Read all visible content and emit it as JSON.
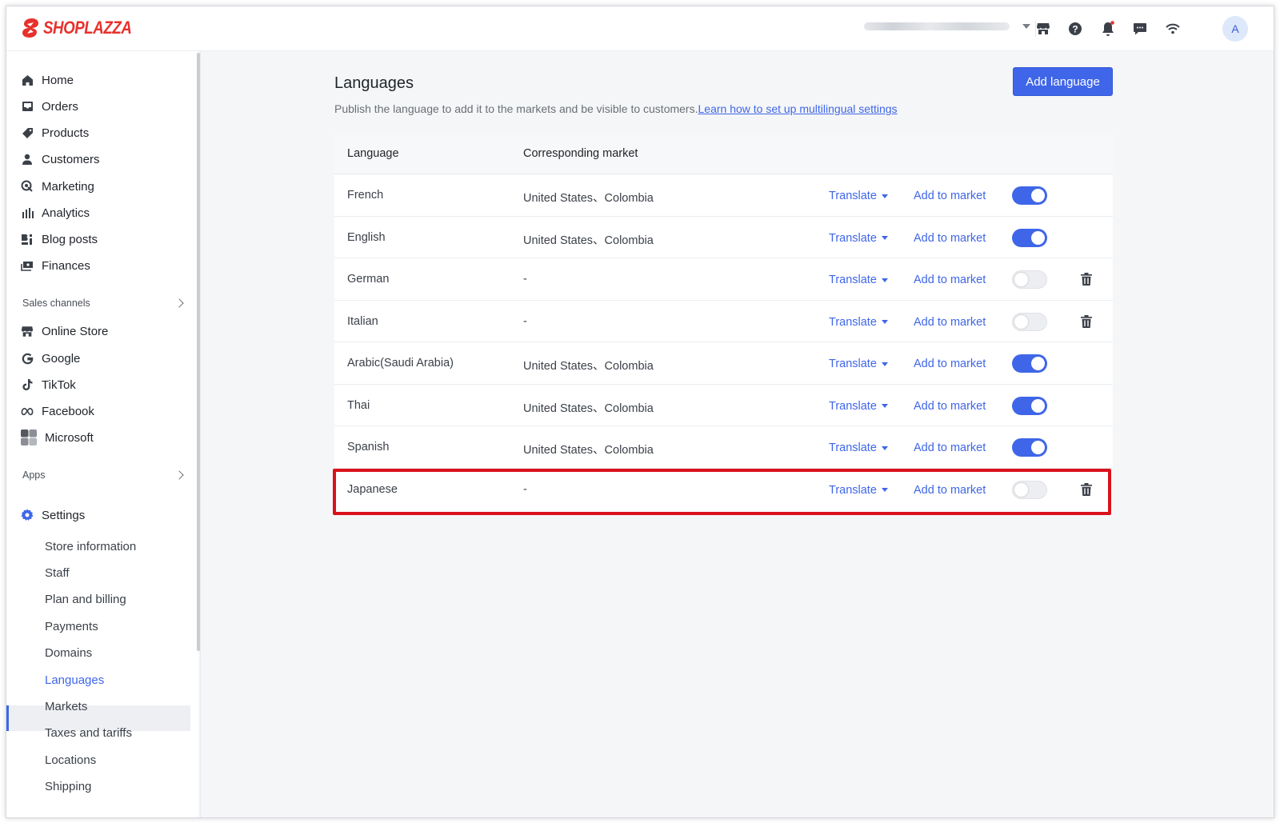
{
  "brand": {
    "name": "SHOPLAZZA",
    "color": "#e7312d"
  },
  "topbar": {
    "icons": [
      "store-icon",
      "help-icon",
      "notification-icon",
      "message-icon",
      "wifi-icon"
    ],
    "avatar_letter": "A"
  },
  "sidebar": {
    "nav": [
      {
        "label": "Home",
        "icon": "home-icon"
      },
      {
        "label": "Orders",
        "icon": "orders-icon"
      },
      {
        "label": "Products",
        "icon": "tag-icon"
      },
      {
        "label": "Customers",
        "icon": "person-icon"
      },
      {
        "label": "Marketing",
        "icon": "marketing-icon"
      },
      {
        "label": "Analytics",
        "icon": "bar-chart-icon"
      },
      {
        "label": "Blog posts",
        "icon": "blog-icon"
      },
      {
        "label": "Finances",
        "icon": "finance-icon"
      }
    ],
    "sales_channels_label": "Sales channels",
    "channels": [
      {
        "label": "Online Store",
        "icon": "store-icon"
      },
      {
        "label": "Google",
        "icon": "google-icon"
      },
      {
        "label": "TikTok",
        "icon": "tiktok-icon"
      },
      {
        "label": "Facebook",
        "icon": "meta-icon"
      },
      {
        "label": "Microsoft",
        "icon": "microsoft-icon"
      }
    ],
    "apps_label": "Apps",
    "settings_label": "Settings",
    "settings_items": [
      "Store information",
      "Staff",
      "Plan and billing",
      "Payments",
      "Domains",
      "Languages",
      "Markets",
      "Taxes and tariffs",
      "Locations",
      "Shipping"
    ],
    "active_item": "Languages"
  },
  "main": {
    "title": "Languages",
    "description": "Publish the language to add it to the markets and be visible to customers.",
    "link_text": "Learn how to set up multilingual settings",
    "add_button": "Add language",
    "columns": [
      "Language",
      "Corresponding market"
    ],
    "translate_label": "Translate",
    "add_to_market_label": "Add to market",
    "rows": [
      {
        "language": "French",
        "market": "United States、Colombia",
        "published": true,
        "deletable": false
      },
      {
        "language": "English",
        "market": "United States、Colombia",
        "published": true,
        "deletable": false
      },
      {
        "language": "German",
        "market": "-",
        "published": false,
        "deletable": true
      },
      {
        "language": "Italian",
        "market": "-",
        "published": false,
        "deletable": true
      },
      {
        "language": "Arabic(Saudi Arabia)",
        "market": "United States、Colombia",
        "published": true,
        "deletable": false
      },
      {
        "language": "Thai",
        "market": "United States、Colombia",
        "published": true,
        "deletable": false
      },
      {
        "language": "Spanish",
        "market": "United States、Colombia",
        "published": true,
        "deletable": false
      },
      {
        "language": "Japanese",
        "market": "-",
        "published": false,
        "deletable": true
      }
    ],
    "highlighted_row": "Japanese"
  },
  "colors": {
    "accent": "#3f66e8",
    "highlight": "#d9121c"
  }
}
